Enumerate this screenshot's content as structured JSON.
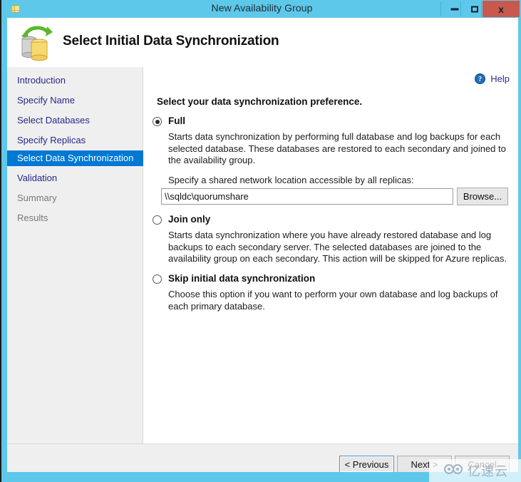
{
  "window": {
    "title": "New Availability Group",
    "app_icon": "database-wizard-icon",
    "controls": {
      "minimize": "Minimize",
      "maximize": "Maximize",
      "close": "x"
    },
    "frame_color": "#5ec8ea",
    "close_color": "#c9584f"
  },
  "header": {
    "title": "Select Initial Data Synchronization",
    "icon": "data-synchronization-icon"
  },
  "sidebar": {
    "items": [
      {
        "label": "Introduction",
        "state": "done"
      },
      {
        "label": "Specify Name",
        "state": "done"
      },
      {
        "label": "Select Databases",
        "state": "done"
      },
      {
        "label": "Specify Replicas",
        "state": "done"
      },
      {
        "label": "Select Data Synchronization",
        "state": "active"
      },
      {
        "label": "Validation",
        "state": "done"
      },
      {
        "label": "Summary",
        "state": "disabled"
      },
      {
        "label": "Results",
        "state": "disabled"
      }
    ],
    "active_color": "#0078d4",
    "link_color": "#2b2b8f"
  },
  "content": {
    "help_label": "Help",
    "help_icon": "help-circle-icon",
    "heading": "Select your data synchronization preference.",
    "options": [
      {
        "id": "full",
        "label": "Full",
        "selected": true,
        "description": "Starts data synchronization by performing full database and log backups for each selected database. These databases are restored to each secondary and joined to the availability group."
      },
      {
        "id": "join-only",
        "label": "Join only",
        "selected": false,
        "description": "Starts data synchronization where you have already restored database and log backups to each secondary server. The selected databases are joined to the availability group on each secondary. This action will be skipped for Azure replicas."
      },
      {
        "id": "skip-initial",
        "label": "Skip initial data synchronization",
        "selected": false,
        "description": "Choose this option if you want to perform your own database and log backups of each primary database."
      }
    ],
    "share": {
      "label": "Specify a shared network location accessible by all replicas:",
      "value": "\\\\sqldc\\quorumshare",
      "placeholder": "",
      "browse_label": "Browse..."
    }
  },
  "footer": {
    "previous_label": "< Previous",
    "next_label": "Next >",
    "cancel_label": "Cancel"
  },
  "watermark": {
    "text": "亿速云",
    "logo": "cloud-logo-icon"
  }
}
